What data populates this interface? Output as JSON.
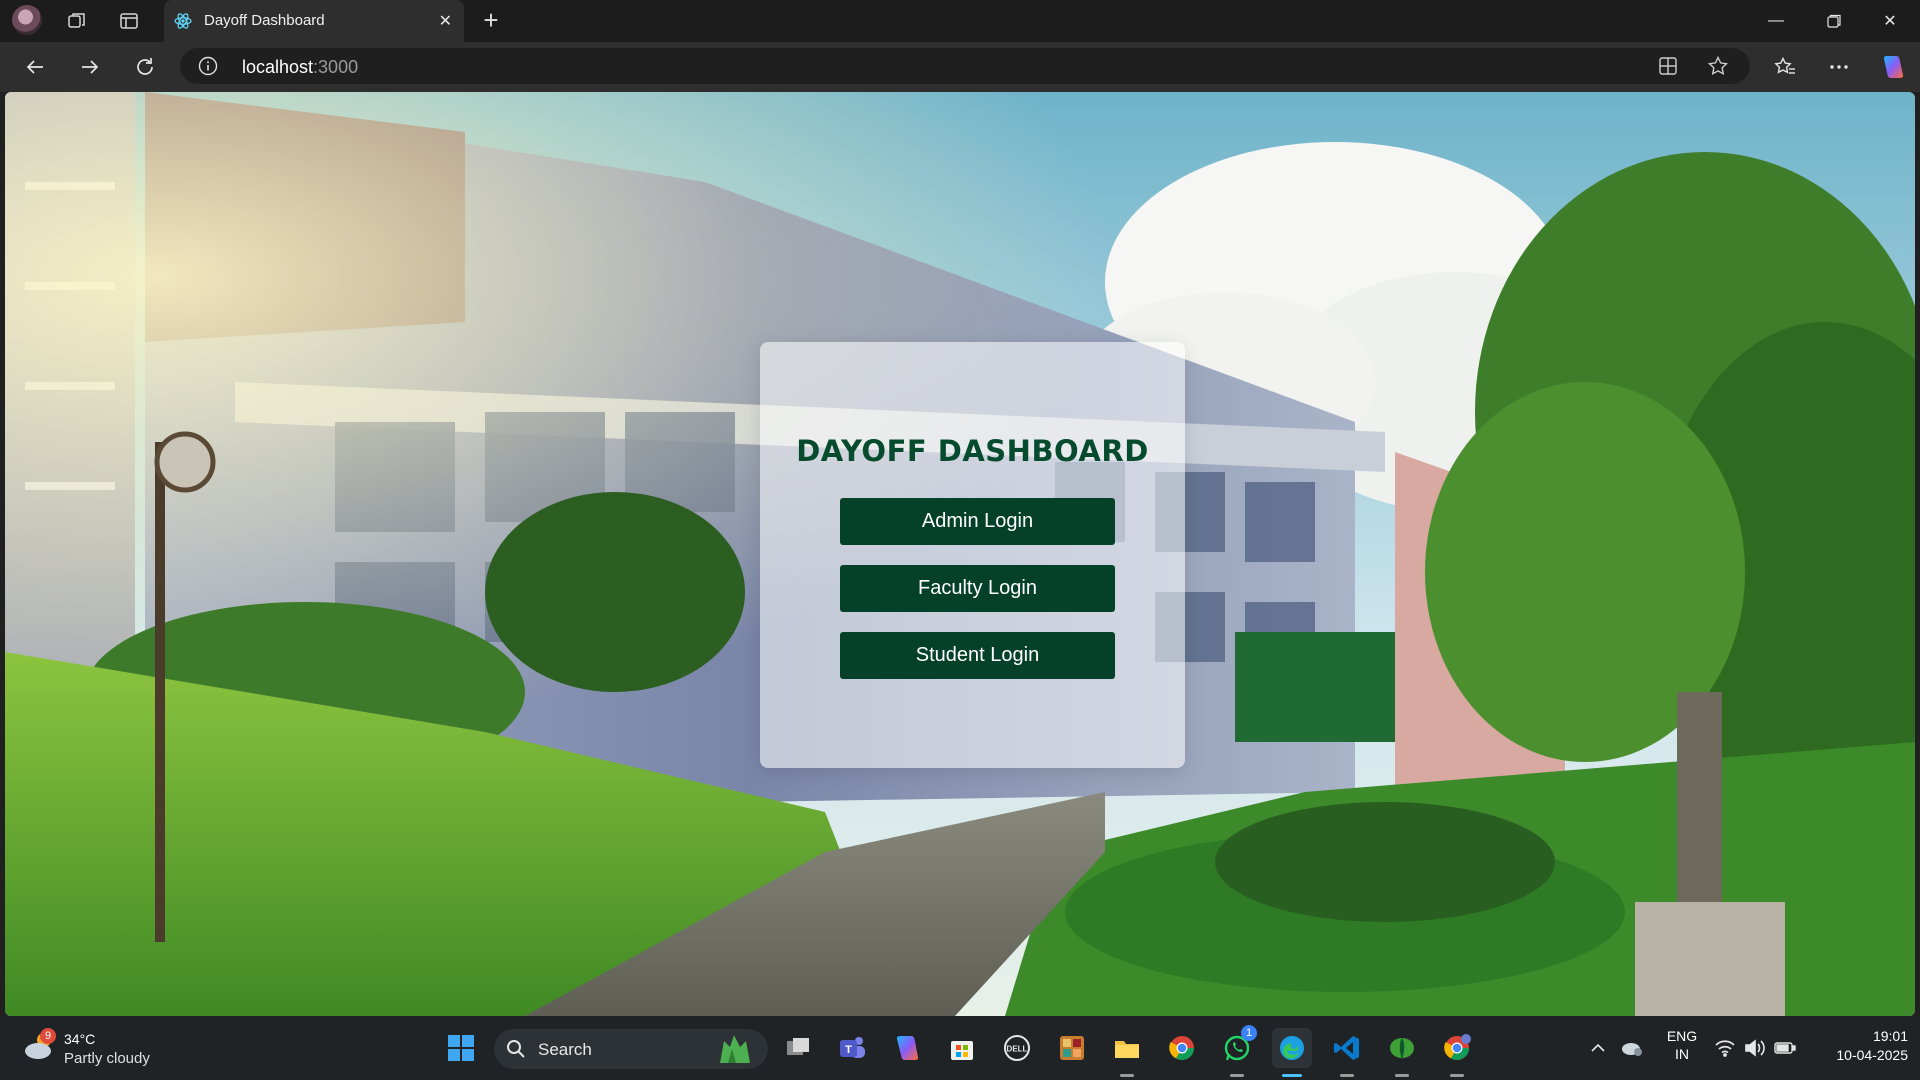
{
  "browser": {
    "tab_title": "Dayoff Dashboard",
    "url_host": "localhost",
    "url_port": ":3000"
  },
  "page": {
    "heading": "DAYOFF DASHBOARD",
    "buttons": {
      "admin": "Admin Login",
      "faculty": "Faculty Login",
      "student": "Student Login"
    },
    "colors": {
      "heading": "#064b2e",
      "button_bg": "#044128",
      "button_text": "#ffffff"
    }
  },
  "taskbar": {
    "weather_badge": "9",
    "weather_temp": "34°C",
    "weather_desc": "Partly cloudy",
    "search_placeholder": "Search",
    "whatsapp_badge": "1",
    "lang_line1": "ENG",
    "lang_line2": "IN",
    "time": "19:01",
    "date": "10-04-2025"
  }
}
